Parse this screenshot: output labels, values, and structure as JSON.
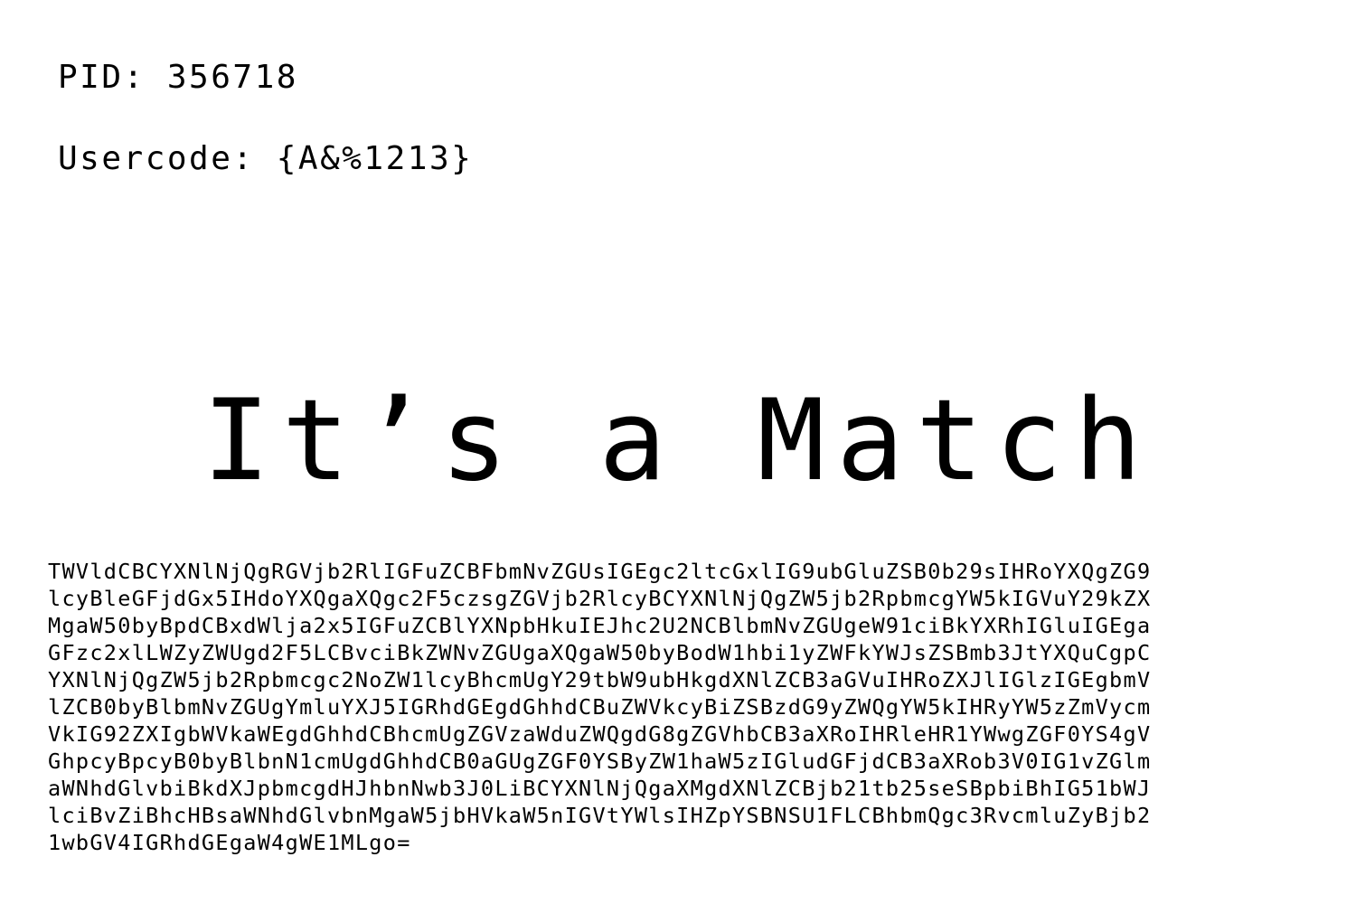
{
  "header": {
    "pid": "PID: 356718",
    "usercode": "Usercode: {A&%1213}"
  },
  "main": {
    "headline": "It’s a Match"
  },
  "encoded": {
    "lines": [
      "TWVldCBCYXNlNjQgRGVjb2RlIGFuZCBFbmNvZGUsIGEgc2ltcGxlIG9ubGluZSB0b29sIHRoYXQgZG9",
      "lcyBleGFjdGx5IHdoYXQgaXQgc2F5czsgZGVjb2RlcyBCYXNlNjQgZW5jb2RpbmcgYW5kIGVuY29kZX",
      "MgaW50byBpdCBxdWlja2x5IGFuZCBlYXNpbHkuIEJhc2U2NCBlbmNvZGUgeW91ciBkYXRhIGluIGEga",
      "GFzc2xlLWZyZWUgd2F5LCBvciBkZWNvZGUgaXQgaW50byBodW1hbi1yZWFkYWJsZSBmb3JtYXQuCgpC",
      "YXNlNjQgZW5jb2Rpbmcgc2NoZW1lcyBhcmUgY29tbW9ubHkgdXNlZCB3aGVuIHRoZXJlIGlzIGEgbmV",
      "lZCB0byBlbmNvZGUgYmluYXJ5IGRhdGEgdGhhdCBuZWVkcyBiZSBzdG9yZWQgYW5kIHRyYW5zZmVycm",
      "VkIG92ZXIgbWVkaWEgdGhhdCBhcmUgZGVzaWduZWQgdG8gZGVhbCB3aXRoIHRleHR1YWwgZGF0YS4gV",
      "GhpcyBpcyB0byBlbnN1cmUgdGhhdCB0aGUgZGF0YSByZW1haW5zIGludGFjdCB3aXRob3V0IG1vZGlm",
      "aWNhdGlvbiBkdXJpbmcgdHJhbnNwb3J0LiBCYXNlNjQgaXMgdXNlZCBjb21tb25seSBpbiBhIG51bWJ",
      "lciBvZiBhcHBsaWNhdGlvbnMgaW5jbHVkaW5nIGVtYWlsIHZpYSBNSU1FLCBhbmQgc3RvcmluZyBjb2",
      "1wbGV4IGRhdGEgaW4gWE1MLgo="
    ]
  }
}
